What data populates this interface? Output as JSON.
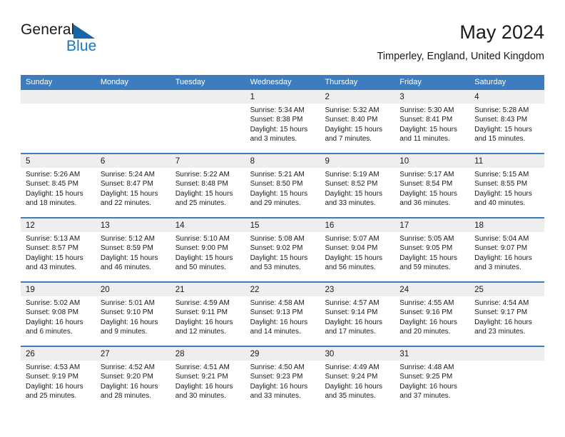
{
  "brand": {
    "name_part1": "General",
    "name_part2": "Blue",
    "triangle_icon": "blue-triangle-icon",
    "accent_color": "#1577c4",
    "header_color": "#3c7cbf"
  },
  "header": {
    "title": "May 2024",
    "subtitle": "Timperley, England, United Kingdom"
  },
  "calendar": {
    "weekdays": [
      "Sunday",
      "Monday",
      "Tuesday",
      "Wednesday",
      "Thursday",
      "Friday",
      "Saturday"
    ],
    "weeks": [
      [
        {
          "day": "",
          "sunrise": "",
          "sunset": "",
          "daylight": ""
        },
        {
          "day": "",
          "sunrise": "",
          "sunset": "",
          "daylight": ""
        },
        {
          "day": "",
          "sunrise": "",
          "sunset": "",
          "daylight": ""
        },
        {
          "day": "1",
          "sunrise": "Sunrise: 5:34 AM",
          "sunset": "Sunset: 8:38 PM",
          "daylight": "Daylight: 15 hours and 3 minutes."
        },
        {
          "day": "2",
          "sunrise": "Sunrise: 5:32 AM",
          "sunset": "Sunset: 8:40 PM",
          "daylight": "Daylight: 15 hours and 7 minutes."
        },
        {
          "day": "3",
          "sunrise": "Sunrise: 5:30 AM",
          "sunset": "Sunset: 8:41 PM",
          "daylight": "Daylight: 15 hours and 11 minutes."
        },
        {
          "day": "4",
          "sunrise": "Sunrise: 5:28 AM",
          "sunset": "Sunset: 8:43 PM",
          "daylight": "Daylight: 15 hours and 15 minutes."
        }
      ],
      [
        {
          "day": "5",
          "sunrise": "Sunrise: 5:26 AM",
          "sunset": "Sunset: 8:45 PM",
          "daylight": "Daylight: 15 hours and 18 minutes."
        },
        {
          "day": "6",
          "sunrise": "Sunrise: 5:24 AM",
          "sunset": "Sunset: 8:47 PM",
          "daylight": "Daylight: 15 hours and 22 minutes."
        },
        {
          "day": "7",
          "sunrise": "Sunrise: 5:22 AM",
          "sunset": "Sunset: 8:48 PM",
          "daylight": "Daylight: 15 hours and 25 minutes."
        },
        {
          "day": "8",
          "sunrise": "Sunrise: 5:21 AM",
          "sunset": "Sunset: 8:50 PM",
          "daylight": "Daylight: 15 hours and 29 minutes."
        },
        {
          "day": "9",
          "sunrise": "Sunrise: 5:19 AM",
          "sunset": "Sunset: 8:52 PM",
          "daylight": "Daylight: 15 hours and 33 minutes."
        },
        {
          "day": "10",
          "sunrise": "Sunrise: 5:17 AM",
          "sunset": "Sunset: 8:54 PM",
          "daylight": "Daylight: 15 hours and 36 minutes."
        },
        {
          "day": "11",
          "sunrise": "Sunrise: 5:15 AM",
          "sunset": "Sunset: 8:55 PM",
          "daylight": "Daylight: 15 hours and 40 minutes."
        }
      ],
      [
        {
          "day": "12",
          "sunrise": "Sunrise: 5:13 AM",
          "sunset": "Sunset: 8:57 PM",
          "daylight": "Daylight: 15 hours and 43 minutes."
        },
        {
          "day": "13",
          "sunrise": "Sunrise: 5:12 AM",
          "sunset": "Sunset: 8:59 PM",
          "daylight": "Daylight: 15 hours and 46 minutes."
        },
        {
          "day": "14",
          "sunrise": "Sunrise: 5:10 AM",
          "sunset": "Sunset: 9:00 PM",
          "daylight": "Daylight: 15 hours and 50 minutes."
        },
        {
          "day": "15",
          "sunrise": "Sunrise: 5:08 AM",
          "sunset": "Sunset: 9:02 PM",
          "daylight": "Daylight: 15 hours and 53 minutes."
        },
        {
          "day": "16",
          "sunrise": "Sunrise: 5:07 AM",
          "sunset": "Sunset: 9:04 PM",
          "daylight": "Daylight: 15 hours and 56 minutes."
        },
        {
          "day": "17",
          "sunrise": "Sunrise: 5:05 AM",
          "sunset": "Sunset: 9:05 PM",
          "daylight": "Daylight: 15 hours and 59 minutes."
        },
        {
          "day": "18",
          "sunrise": "Sunrise: 5:04 AM",
          "sunset": "Sunset: 9:07 PM",
          "daylight": "Daylight: 16 hours and 3 minutes."
        }
      ],
      [
        {
          "day": "19",
          "sunrise": "Sunrise: 5:02 AM",
          "sunset": "Sunset: 9:08 PM",
          "daylight": "Daylight: 16 hours and 6 minutes."
        },
        {
          "day": "20",
          "sunrise": "Sunrise: 5:01 AM",
          "sunset": "Sunset: 9:10 PM",
          "daylight": "Daylight: 16 hours and 9 minutes."
        },
        {
          "day": "21",
          "sunrise": "Sunrise: 4:59 AM",
          "sunset": "Sunset: 9:11 PM",
          "daylight": "Daylight: 16 hours and 12 minutes."
        },
        {
          "day": "22",
          "sunrise": "Sunrise: 4:58 AM",
          "sunset": "Sunset: 9:13 PM",
          "daylight": "Daylight: 16 hours and 14 minutes."
        },
        {
          "day": "23",
          "sunrise": "Sunrise: 4:57 AM",
          "sunset": "Sunset: 9:14 PM",
          "daylight": "Daylight: 16 hours and 17 minutes."
        },
        {
          "day": "24",
          "sunrise": "Sunrise: 4:55 AM",
          "sunset": "Sunset: 9:16 PM",
          "daylight": "Daylight: 16 hours and 20 minutes."
        },
        {
          "day": "25",
          "sunrise": "Sunrise: 4:54 AM",
          "sunset": "Sunset: 9:17 PM",
          "daylight": "Daylight: 16 hours and 23 minutes."
        }
      ],
      [
        {
          "day": "26",
          "sunrise": "Sunrise: 4:53 AM",
          "sunset": "Sunset: 9:19 PM",
          "daylight": "Daylight: 16 hours and 25 minutes."
        },
        {
          "day": "27",
          "sunrise": "Sunrise: 4:52 AM",
          "sunset": "Sunset: 9:20 PM",
          "daylight": "Daylight: 16 hours and 28 minutes."
        },
        {
          "day": "28",
          "sunrise": "Sunrise: 4:51 AM",
          "sunset": "Sunset: 9:21 PM",
          "daylight": "Daylight: 16 hours and 30 minutes."
        },
        {
          "day": "29",
          "sunrise": "Sunrise: 4:50 AM",
          "sunset": "Sunset: 9:23 PM",
          "daylight": "Daylight: 16 hours and 33 minutes."
        },
        {
          "day": "30",
          "sunrise": "Sunrise: 4:49 AM",
          "sunset": "Sunset: 9:24 PM",
          "daylight": "Daylight: 16 hours and 35 minutes."
        },
        {
          "day": "31",
          "sunrise": "Sunrise: 4:48 AM",
          "sunset": "Sunset: 9:25 PM",
          "daylight": "Daylight: 16 hours and 37 minutes."
        },
        {
          "day": "",
          "sunrise": "",
          "sunset": "",
          "daylight": ""
        }
      ]
    ]
  }
}
